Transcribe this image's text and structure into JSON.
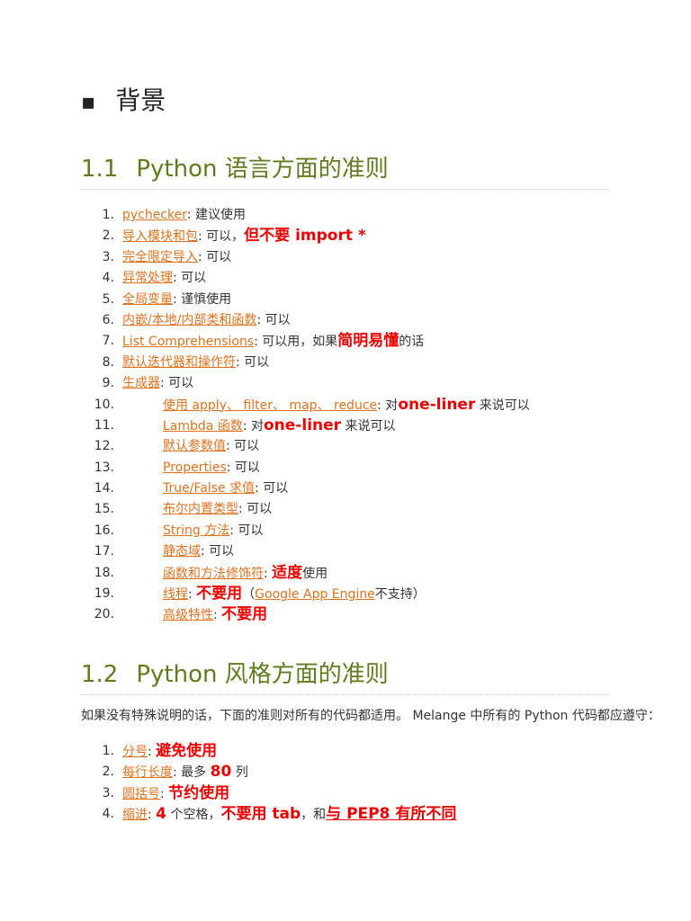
{
  "title": {
    "bullet": "▪",
    "text": "背景"
  },
  "section1": {
    "num": "1.1",
    "title": "Python 语言方面的准则",
    "items": [
      {
        "n": "1.",
        "link": "pychecker",
        "rest": ": 建议使用"
      },
      {
        "n": "2.",
        "link": "导入模块和包",
        "rest": ": 可以，",
        "em": "但不要 import *"
      },
      {
        "n": "3.",
        "link": "完全限定导入",
        "rest": ": 可以"
      },
      {
        "n": "4.",
        "link": "异常处理",
        "rest": ": 可以"
      },
      {
        "n": "5.",
        "link": "全局变量",
        "rest": ": 谨慎使用"
      },
      {
        "n": "6.",
        "link": "内嵌/本地/内部类和函数",
        "rest": ": 可以"
      },
      {
        "n": "7.",
        "link": "List Comprehensions",
        "rest": ": 可以用，如果",
        "em": "简明易懂",
        "rest2": "的话"
      },
      {
        "n": "8.",
        "link": "默认迭代器和操作符",
        "rest": ": 可以"
      },
      {
        "n": "9.",
        "link": "生成器",
        "rest": ": 可以"
      },
      {
        "n": "10.",
        "link": "使用 apply、 filter、 map、 reduce",
        "rest": ": 对",
        "em": "one-liner",
        "rest2": " 来说可以"
      },
      {
        "n": "11.",
        "link": "Lambda 函数",
        "rest": ": 对",
        "em": "one-liner",
        "rest2": " 来说可以"
      },
      {
        "n": "12.",
        "link": "默认参数值",
        "rest": ": 可以"
      },
      {
        "n": "13.",
        "link": "Properties",
        "rest": ": 可以"
      },
      {
        "n": "14.",
        "link": "True/False 求值",
        "rest": ": 可以"
      },
      {
        "n": "15.",
        "link": "布尔内置类型",
        "rest": ": 可以"
      },
      {
        "n": "16.",
        "link": "String 方法",
        "rest": ": 可以"
      },
      {
        "n": "17.",
        "link": "静态域",
        "rest": ": 可以"
      },
      {
        "n": "18.",
        "link": "函数和方法修饰符",
        "rest": ": ",
        "em": "适度",
        "rest2": "使用"
      },
      {
        "n": "19.",
        "link": "线程",
        "rest": ": ",
        "em": "不要用",
        "rest2": "（",
        "link2": "Google App Engine",
        "rest3": "不支持）"
      },
      {
        "n": "20.",
        "link": "高级特性",
        "rest": ": ",
        "em": "不要用"
      }
    ]
  },
  "section2": {
    "num": "1.2",
    "title": "Python 风格方面的准则",
    "intro": "如果没有特殊说明的话，下面的准则对所有的代码都适用。 Melange 中所有的 Python 代码都应遵守：",
    "items": [
      {
        "n": "1.",
        "link": "分号",
        "rest": ": ",
        "em": "避免使用"
      },
      {
        "n": "2.",
        "link": "每行长度",
        "rest": ": 最多 ",
        "em": "80",
        "rest2": " 列"
      },
      {
        "n": "3.",
        "link": "圆括号",
        "rest": ": ",
        "em": "节约使用"
      },
      {
        "n": "4.",
        "link": "缩进",
        "rest": ": ",
        "em": "4",
        "rest2": " 个空格，",
        "em2": "不要用 tab",
        "rest3": "，和",
        "em3": "与 PEP8 有所不同"
      }
    ]
  }
}
